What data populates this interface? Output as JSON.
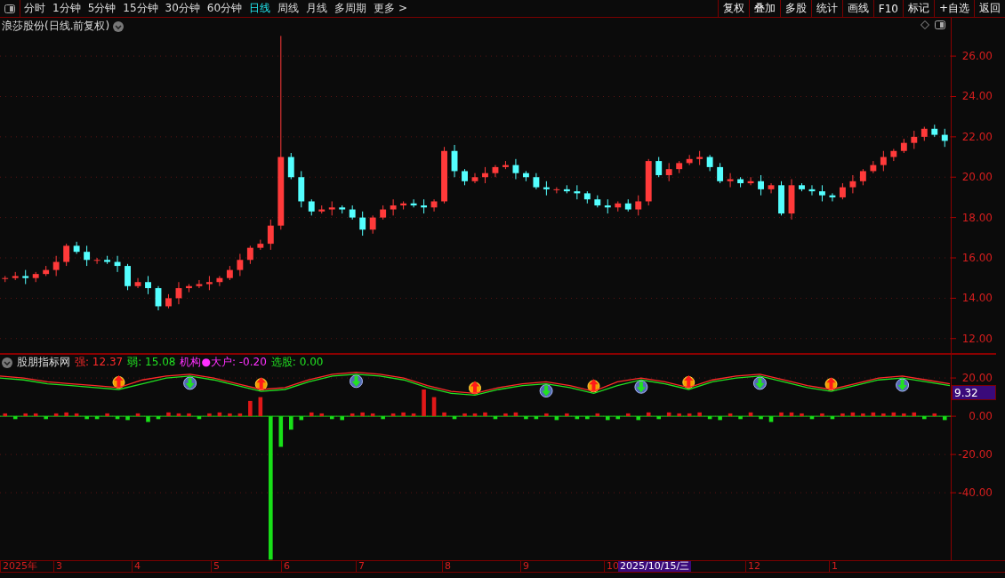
{
  "toolbar": {
    "periods": [
      {
        "label": "分时",
        "selected": false
      },
      {
        "label": "1分钟",
        "selected": false
      },
      {
        "label": "5分钟",
        "selected": false
      },
      {
        "label": "15分钟",
        "selected": false
      },
      {
        "label": "30分钟",
        "selected": false
      },
      {
        "label": "60分钟",
        "selected": false
      },
      {
        "label": "日线",
        "selected": true
      },
      {
        "label": "周线",
        "selected": false
      },
      {
        "label": "月线",
        "selected": false
      },
      {
        "label": "多周期",
        "selected": false
      },
      {
        "label": "更多 >",
        "selected": false
      }
    ],
    "actions": [
      "复权",
      "叠加",
      "多股",
      "统计",
      "画线",
      "F10",
      "标记",
      "+自选",
      "返回"
    ]
  },
  "main_chart": {
    "title": "浪莎股份(日线.前复权)",
    "chart_data": {
      "type": "candlestick",
      "grid": true,
      "ohlc": [
        [
          15.0,
          15.1,
          14.8,
          15.0
        ],
        [
          15.0,
          15.3,
          14.9,
          15.1
        ],
        [
          15.1,
          15.4,
          14.7,
          15.0
        ],
        [
          15.0,
          15.3,
          14.8,
          15.2
        ],
        [
          15.2,
          15.6,
          15.1,
          15.4
        ],
        [
          15.4,
          16.1,
          15.1,
          15.8
        ],
        [
          15.8,
          16.7,
          15.6,
          16.6
        ],
        [
          16.6,
          16.8,
          16.2,
          16.3
        ],
        [
          16.3,
          16.6,
          15.6,
          15.9
        ],
        [
          15.9,
          16.0,
          15.7,
          15.9
        ],
        [
          15.9,
          16.1,
          15.7,
          15.8
        ],
        [
          15.8,
          16.1,
          15.3,
          15.6
        ],
        [
          15.6,
          15.7,
          14.4,
          14.6
        ],
        [
          14.6,
          15.0,
          14.5,
          14.8
        ],
        [
          14.8,
          15.1,
          14.2,
          14.5
        ],
        [
          14.5,
          14.6,
          13.4,
          13.6
        ],
        [
          13.6,
          14.2,
          13.5,
          14.0
        ],
        [
          14.0,
          14.8,
          13.7,
          14.5
        ],
        [
          14.5,
          14.7,
          14.3,
          14.6
        ],
        [
          14.6,
          14.9,
          14.5,
          14.7
        ],
        [
          14.7,
          15.1,
          14.4,
          14.8
        ],
        [
          14.8,
          15.1,
          14.6,
          15.0
        ],
        [
          15.0,
          15.6,
          14.9,
          15.4
        ],
        [
          15.4,
          16.2,
          15.1,
          15.9
        ],
        [
          15.9,
          16.6,
          15.7,
          16.5
        ],
        [
          16.5,
          16.9,
          16.4,
          16.7
        ],
        [
          16.7,
          17.9,
          16.4,
          17.6
        ],
        [
          17.6,
          27.0,
          17.4,
          21.0
        ],
        [
          21.0,
          21.2,
          19.9,
          20.0
        ],
        [
          20.0,
          20.3,
          18.5,
          18.8
        ],
        [
          18.8,
          18.9,
          18.1,
          18.3
        ],
        [
          18.3,
          18.6,
          18.2,
          18.4
        ],
        [
          18.4,
          18.8,
          18.1,
          18.5
        ],
        [
          18.5,
          18.6,
          18.2,
          18.4
        ],
        [
          18.4,
          18.6,
          17.9,
          18.0
        ],
        [
          18.0,
          18.3,
          17.1,
          17.4
        ],
        [
          17.4,
          18.1,
          17.2,
          18.0
        ],
        [
          18.0,
          18.6,
          17.9,
          18.4
        ],
        [
          18.4,
          18.9,
          18.1,
          18.6
        ],
        [
          18.6,
          18.8,
          18.4,
          18.7
        ],
        [
          18.7,
          18.9,
          18.5,
          18.6
        ],
        [
          18.6,
          18.9,
          18.2,
          18.5
        ],
        [
          18.5,
          18.9,
          18.3,
          18.8
        ],
        [
          18.8,
          21.5,
          18.7,
          21.3
        ],
        [
          21.3,
          21.6,
          20.0,
          20.3
        ],
        [
          20.3,
          20.4,
          19.6,
          19.8
        ],
        [
          19.8,
          20.2,
          19.7,
          20.0
        ],
        [
          20.0,
          20.5,
          19.7,
          20.2
        ],
        [
          20.2,
          20.6,
          20.0,
          20.5
        ],
        [
          20.5,
          20.8,
          20.4,
          20.6
        ],
        [
          20.6,
          20.9,
          19.9,
          20.2
        ],
        [
          20.2,
          20.3,
          19.8,
          20.0
        ],
        [
          20.0,
          20.2,
          19.4,
          19.5
        ],
        [
          19.5,
          19.8,
          19.1,
          19.4
        ],
        [
          19.4,
          19.5,
          19.2,
          19.4
        ],
        [
          19.4,
          19.6,
          19.2,
          19.3
        ],
        [
          19.3,
          19.6,
          18.9,
          19.2
        ],
        [
          19.2,
          19.3,
          18.7,
          18.9
        ],
        [
          18.9,
          19.1,
          18.5,
          18.6
        ],
        [
          18.6,
          18.9,
          18.2,
          18.5
        ],
        [
          18.5,
          18.8,
          18.3,
          18.7
        ],
        [
          18.7,
          18.9,
          18.3,
          18.4
        ],
        [
          18.4,
          19.1,
          18.1,
          18.8
        ],
        [
          18.8,
          20.9,
          18.6,
          20.8
        ],
        [
          20.8,
          21.0,
          20.0,
          20.1
        ],
        [
          20.1,
          20.7,
          19.8,
          20.4
        ],
        [
          20.4,
          20.8,
          20.2,
          20.7
        ],
        [
          20.7,
          21.1,
          20.6,
          20.9
        ],
        [
          20.9,
          21.3,
          20.6,
          21.0
        ],
        [
          21.0,
          21.1,
          20.3,
          20.5
        ],
        [
          20.5,
          20.7,
          19.7,
          19.8
        ],
        [
          19.8,
          20.2,
          19.5,
          19.9
        ],
        [
          19.9,
          20.0,
          19.5,
          19.7
        ],
        [
          19.7,
          20.0,
          19.6,
          19.8
        ],
        [
          19.8,
          20.1,
          19.1,
          19.4
        ],
        [
          19.4,
          19.7,
          19.2,
          19.6
        ],
        [
          19.6,
          19.8,
          18.1,
          18.2
        ],
        [
          18.2,
          19.9,
          17.9,
          19.6
        ],
        [
          19.6,
          19.7,
          19.3,
          19.4
        ],
        [
          19.4,
          19.6,
          19.1,
          19.3
        ],
        [
          19.3,
          19.6,
          18.8,
          19.1
        ],
        [
          19.1,
          19.2,
          18.8,
          19.0
        ],
        [
          19.0,
          19.7,
          18.9,
          19.5
        ],
        [
          19.5,
          20.1,
          19.2,
          19.8
        ],
        [
          19.8,
          20.4,
          19.6,
          20.3
        ],
        [
          20.3,
          20.8,
          20.2,
          20.6
        ],
        [
          20.6,
          21.3,
          20.3,
          21.0
        ],
        [
          21.0,
          21.4,
          20.8,
          21.3
        ],
        [
          21.3,
          21.9,
          21.2,
          21.7
        ],
        [
          21.7,
          22.3,
          21.4,
          22.0
        ],
        [
          22.0,
          22.5,
          21.8,
          22.4
        ],
        [
          22.4,
          22.6,
          22.0,
          22.1
        ],
        [
          22.1,
          22.4,
          21.5,
          21.8
        ]
      ],
      "ylim": [
        11.24,
        27.9
      ],
      "yticks": [
        {
          "value": 26,
          "label": "26.00"
        },
        {
          "value": 24,
          "label": "24.00"
        },
        {
          "value": 22,
          "label": "22.00"
        },
        {
          "value": 20,
          "label": "20.00"
        },
        {
          "value": 18,
          "label": "18.00"
        },
        {
          "value": 16,
          "label": "16.00"
        },
        {
          "value": 14,
          "label": "14.00"
        },
        {
          "value": 12,
          "label": "12.00"
        }
      ]
    }
  },
  "indicator": {
    "title": "股朋指标网",
    "legend": [
      {
        "label": "强: 12.37",
        "color": "#ff2a2a"
      },
      {
        "label": "弱: 15.08",
        "color": "#22e022"
      },
      {
        "label": "机构●大户: -0.20",
        "color": "#ff30ff"
      },
      {
        "label": "选股: 0.00",
        "color": "#22e022"
      }
    ],
    "value_tag": "9.32",
    "chart_data": {
      "type": "line",
      "grid": true,
      "series": [
        {
          "color": "#ff2a2a",
          "values": [
            21,
            20,
            18,
            17,
            16,
            15,
            19,
            21,
            22,
            20,
            17,
            14,
            15,
            19,
            22,
            23,
            22,
            20,
            16,
            13,
            12,
            15,
            17,
            18,
            16,
            13,
            18,
            20,
            18,
            15,
            19,
            21,
            22,
            19,
            16,
            14,
            17,
            20,
            21,
            19,
            17
          ]
        },
        {
          "color": "#22e022",
          "values": [
            20,
            19,
            17,
            16,
            15,
            14,
            17,
            20,
            21,
            19,
            16,
            13,
            14,
            18,
            21,
            22,
            21,
            19,
            15,
            12,
            11,
            14,
            16,
            17,
            15,
            12,
            16,
            19,
            17,
            14,
            18,
            20,
            21,
            18,
            15,
            13,
            16,
            19,
            20,
            18,
            16
          ]
        }
      ],
      "ylim": [
        -75.3,
        32.6
      ],
      "yticks": [
        {
          "value": 20,
          "label": "20.00"
        },
        {
          "value": 0,
          "label": "0.00"
        },
        {
          "value": -20,
          "label": "-20.00"
        },
        {
          "value": -40,
          "label": "-40.00"
        }
      ]
    },
    "histogram": {
      "chart_data": {
        "type": "bar",
        "values": [
          1.5,
          -1.5,
          1.5,
          1.5,
          -1.5,
          1.5,
          2,
          1.5,
          -1.5,
          -1.5,
          1.5,
          -1.5,
          -2,
          1.5,
          -3,
          -1.5,
          2,
          1.5,
          1.5,
          -1.5,
          1.5,
          2,
          1.5,
          1.5,
          8,
          10,
          -75,
          -16,
          -7,
          -2,
          2,
          1.5,
          -1.5,
          -2,
          1.5,
          2,
          1.5,
          -1.5,
          1.5,
          2,
          1.5,
          14,
          10,
          2,
          -1.5,
          1.5,
          1.5,
          2,
          -1.5,
          1.5,
          2,
          -1.5,
          -1.5,
          1.5,
          -2,
          1.5,
          -1.5,
          -1.5,
          1.5,
          -2,
          -1.5,
          1.5,
          -2,
          2,
          -1.5,
          2,
          1.5,
          1.5,
          2,
          -1.5,
          -2,
          1.5,
          -1.5,
          2,
          -1.5,
          -3,
          2,
          2,
          1.5,
          -1.5,
          1.5,
          -1.5,
          1.5,
          2,
          1.5,
          2,
          1.5,
          2,
          1.5,
          2,
          -1.5,
          1.5,
          -2
        ],
        "ylim": [
          -75.3,
          32.6
        ]
      }
    }
  },
  "time_axis": {
    "labels": [
      "2025年",
      "3",
      "4",
      "5",
      "6",
      "7",
      "8",
      "9",
      "10",
      "12",
      "1"
    ],
    "cursor_label": "2025/10/15/三"
  }
}
